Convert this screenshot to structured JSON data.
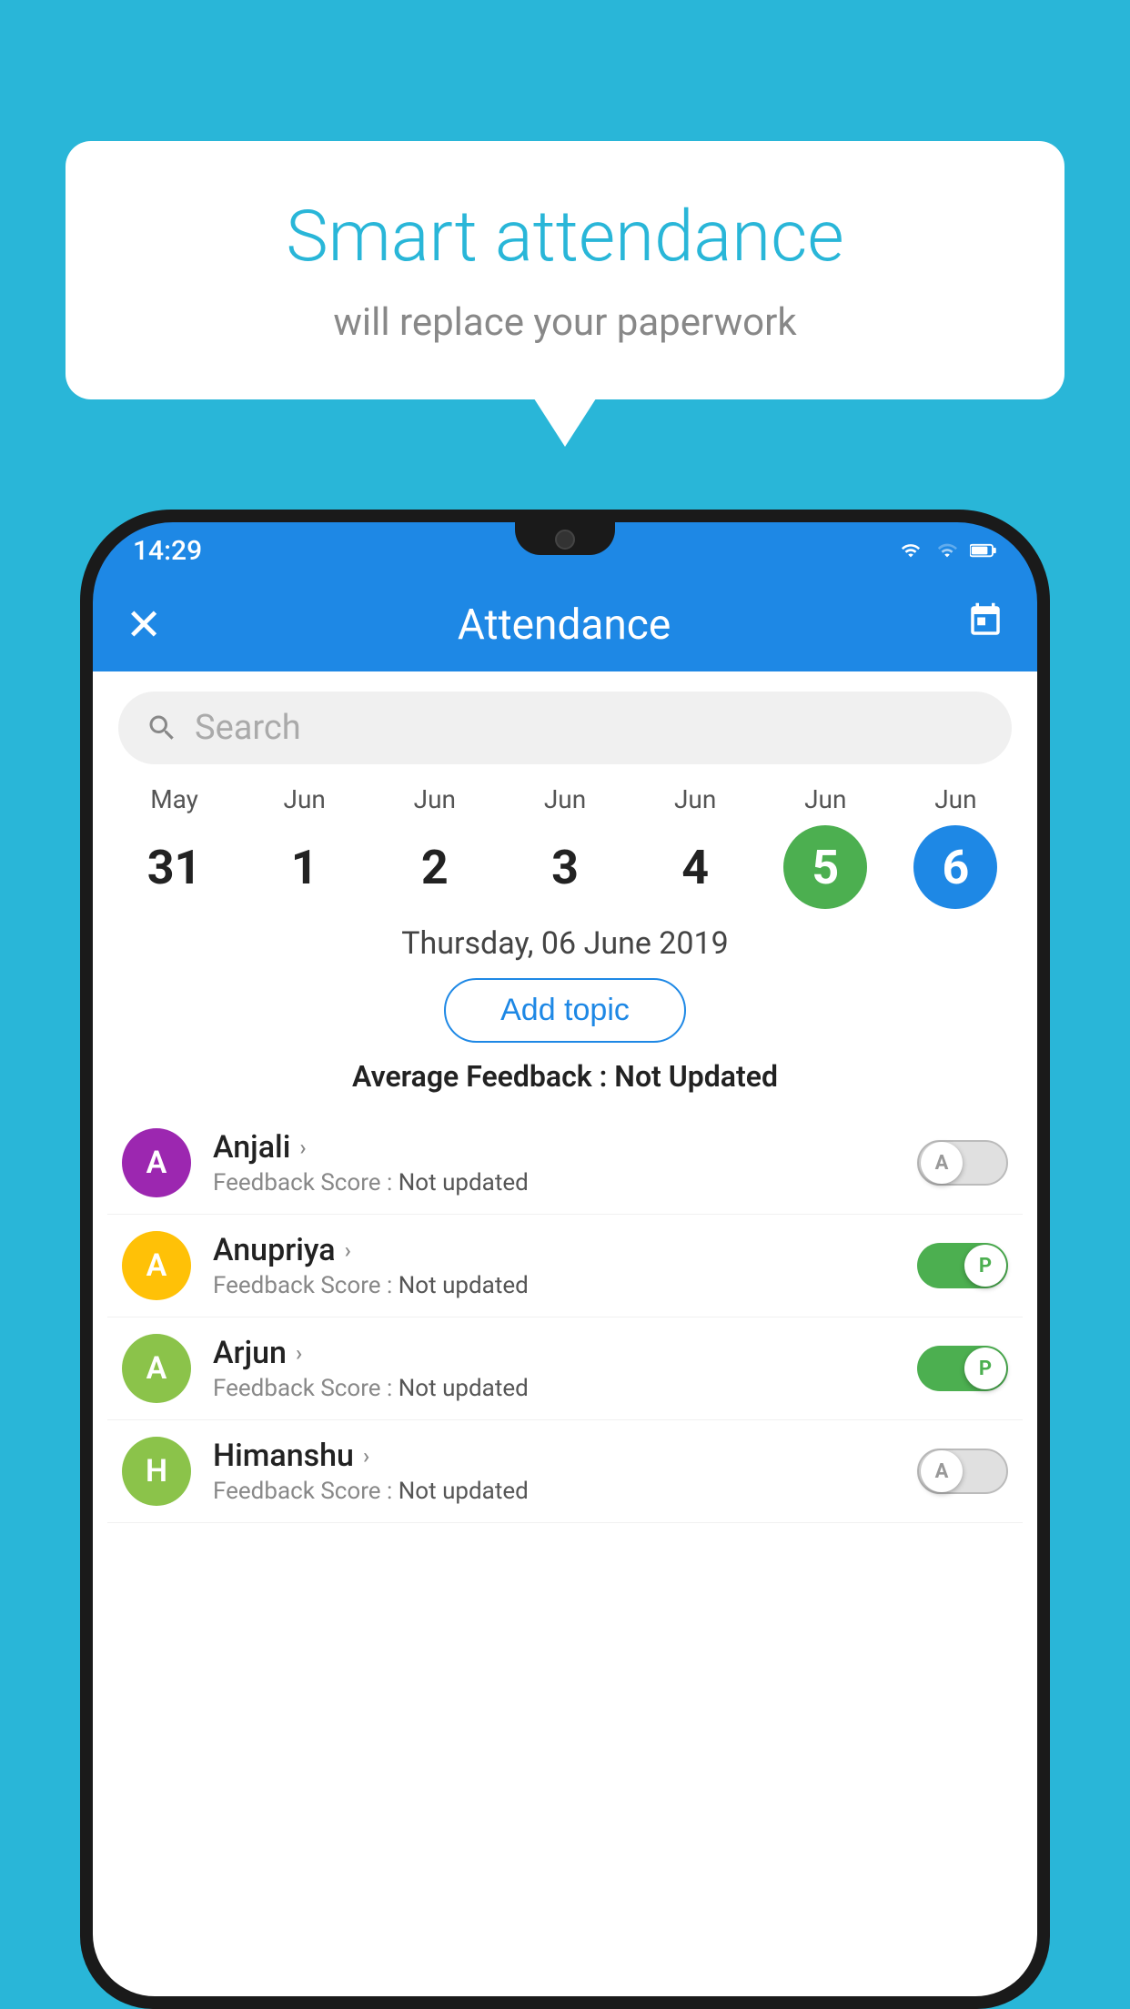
{
  "background": {
    "color": "#29b6d8"
  },
  "speech_bubble": {
    "title": "Smart attendance",
    "subtitle": "will replace your paperwork"
  },
  "status_bar": {
    "time": "14:29"
  },
  "app_bar": {
    "title": "Attendance",
    "close_icon": "✕",
    "calendar_icon": "📅"
  },
  "search": {
    "placeholder": "Search"
  },
  "dates": [
    {
      "month": "May",
      "day": "31",
      "state": "normal"
    },
    {
      "month": "Jun",
      "day": "1",
      "state": "normal"
    },
    {
      "month": "Jun",
      "day": "2",
      "state": "normal"
    },
    {
      "month": "Jun",
      "day": "3",
      "state": "normal"
    },
    {
      "month": "Jun",
      "day": "4",
      "state": "normal"
    },
    {
      "month": "Jun",
      "day": "5",
      "state": "green"
    },
    {
      "month": "Jun",
      "day": "6",
      "state": "blue"
    }
  ],
  "selected_date": "Thursday, 06 June 2019",
  "add_topic_label": "Add topic",
  "avg_feedback": {
    "label": "Average Feedback :",
    "value": "Not Updated"
  },
  "students": [
    {
      "name": "Anjali",
      "avatar_letter": "A",
      "avatar_color": "#9c27b0",
      "feedback_label": "Feedback Score :",
      "feedback_value": "Not updated",
      "toggle_state": "off",
      "toggle_letter": "A"
    },
    {
      "name": "Anupriya",
      "avatar_letter": "A",
      "avatar_color": "#ffc107",
      "feedback_label": "Feedback Score :",
      "feedback_value": "Not updated",
      "toggle_state": "on",
      "toggle_letter": "P"
    },
    {
      "name": "Arjun",
      "avatar_letter": "A",
      "avatar_color": "#8bc34a",
      "feedback_label": "Feedback Score :",
      "feedback_value": "Not updated",
      "toggle_state": "on",
      "toggle_letter": "P"
    },
    {
      "name": "Himanshu",
      "avatar_letter": "H",
      "avatar_color": "#8bc34a",
      "feedback_label": "Feedback Score :",
      "feedback_value": "Not updated",
      "toggle_state": "off",
      "toggle_letter": "A"
    }
  ]
}
